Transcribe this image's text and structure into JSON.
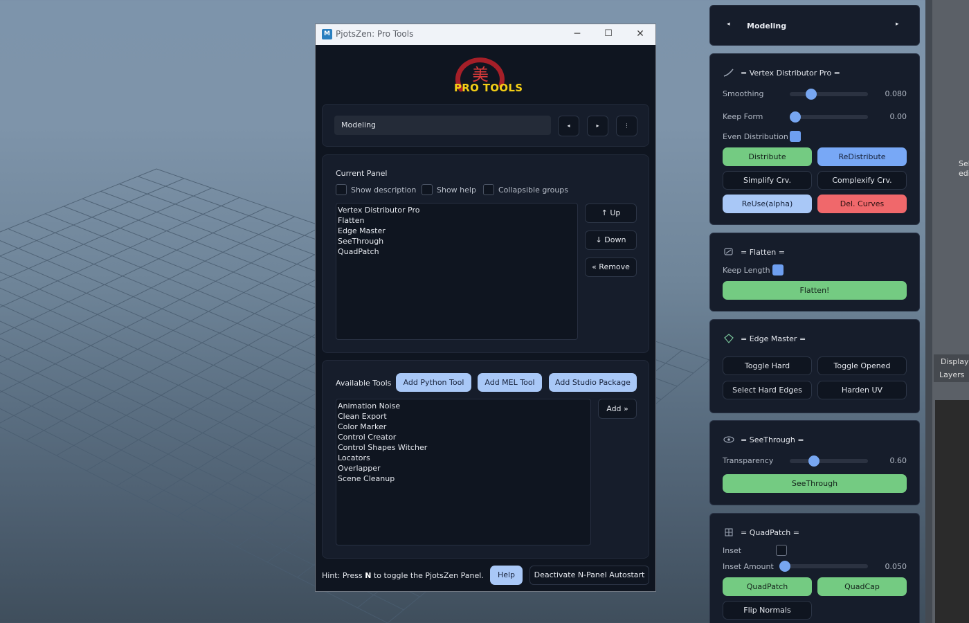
{
  "window": {
    "title": "PjotsZen: Pro Tools",
    "app_icon": "M",
    "logo_text": "PRO TOOLS",
    "logo_glyph": "美",
    "minimize_icon": "─",
    "maximize_icon": "☐",
    "close_icon": "✕"
  },
  "selector": {
    "current": "Modeling",
    "prev_icon": "◂",
    "next_icon": "▸",
    "menu_icon": "⋮"
  },
  "current_panel": {
    "title": "Current Panel",
    "checkboxes": [
      "Show description",
      "Show help",
      "Collapsible groups"
    ],
    "items": [
      "Vertex Distributor Pro",
      "Flatten",
      "Edge Master",
      "SeeThrough",
      "QuadPatch"
    ],
    "up_label": "↑ Up",
    "down_label": "↓ Down",
    "remove_label": "« Remove"
  },
  "available": {
    "title": "Available Tools",
    "add_python": "Add Python Tool",
    "add_mel": "Add MEL Tool",
    "add_package": "Add Studio Package",
    "items": [
      "Animation Noise",
      "Clean Export",
      "Color Marker",
      "Control Creator",
      "Control Shapes Witcher",
      "Locators",
      "Overlapper",
      "Scene Cleanup"
    ],
    "add_label": "Add »"
  },
  "footer": {
    "hint_before": "Hint: Press ",
    "hint_key": "N",
    "hint_after": " to toggle the PjotsZen Panel.",
    "help_label": "Help",
    "deactivate_label": "Deactivate N-Panel Autostart"
  },
  "npanel": {
    "header": {
      "label": "Modeling",
      "prev_icon": "◂",
      "next_icon": "▸"
    },
    "vertex": {
      "title": "= Vertex Distributor Pro =",
      "icon": "curve-icon",
      "smoothing_label": "Smoothing",
      "smoothing_value": "0.080",
      "smoothing_fraction": 0.24,
      "keep_form_label": "Keep Form",
      "keep_form_value": "0.00",
      "keep_form_fraction": 0.0,
      "even_label": "Even Distribution",
      "even_checked": true,
      "distribute": "Distribute",
      "redistribute": "ReDistribute",
      "simplify": "Simplify Crv.",
      "complexify": "Complexify Crv.",
      "reuse": "ReUse(alpha)",
      "del_curves": "Del. Curves"
    },
    "flatten": {
      "title": "= Flatten =",
      "icon": "flatten-icon",
      "keep_length_label": "Keep Length",
      "keep_length_checked": true,
      "flatten_btn": "Flatten!"
    },
    "edge": {
      "title": "= Edge Master =",
      "icon": "diamond-icon",
      "toggle_hard": "Toggle Hard",
      "toggle_opened": "Toggle Opened",
      "select_hard": "Select Hard Edges",
      "harden_uv": "Harden UV"
    },
    "seethrough": {
      "title": "= SeeThrough =",
      "icon": "eye-icon",
      "transparency_label": "Transparency",
      "transparency_value": "0.60",
      "transparency_fraction": 0.28,
      "btn": "SeeThrough"
    },
    "quadpatch": {
      "title": "= QuadPatch =",
      "icon": "grid-icon",
      "inset_label": "Inset",
      "inset_checked": false,
      "inset_amount_label": "Inset Amount",
      "inset_amount_value": "0.050",
      "inset_amount_fraction": 0.0,
      "quadpatch_btn": "QuadPatch",
      "quadcap_btn": "QuadCap",
      "flip_normals": "Flip Normals"
    }
  },
  "maya": {
    "sel_line1": "Sel",
    "sel_line2": "edi",
    "display": "Display",
    "layers": "Layers"
  },
  "colors": {
    "accent_blue": "#a9c8f7",
    "green": "#74cb82",
    "red": "#f0686b",
    "logo_yellow": "#f4cf16",
    "logo_red": "#b3202a"
  }
}
